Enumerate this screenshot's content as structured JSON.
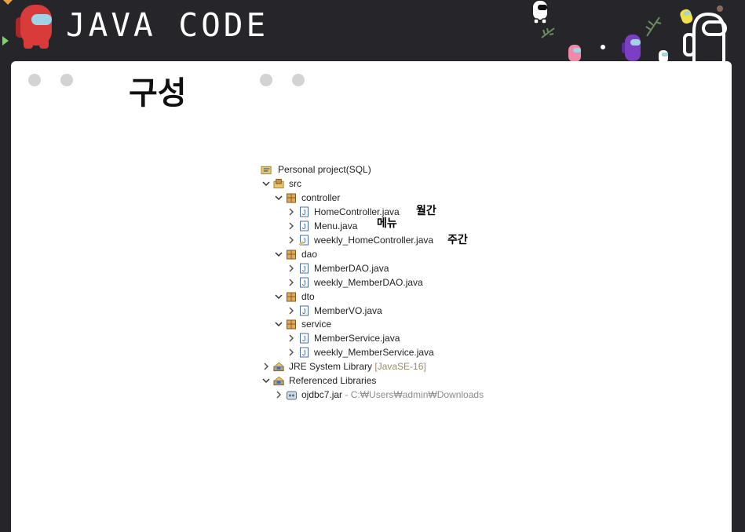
{
  "header": {
    "title": "JAVA CODE"
  },
  "card": {
    "heading": "구성"
  },
  "tree": {
    "project": "Personal project(SQL)",
    "src": "src",
    "pkg_controller": "controller",
    "file_home": "HomeController.java",
    "file_menu": "Menu.java",
    "file_weekly_home": "weekly_HomeController.java",
    "pkg_dao": "dao",
    "file_memberdao": "MemberDAO.java",
    "file_weekly_memberdao": "weekly_MemberDAO.java",
    "pkg_dto": "dto",
    "file_membervo": "MemberVO.java",
    "pkg_service": "service",
    "file_memberservice": "MemberService.java",
    "file_weekly_memberservice": "weekly_MemberService.java",
    "jre_label": "JRE System Library",
    "jre_version": "[JavaSE-16]",
    "ref_libs": "Referenced Libraries",
    "jar_name": "ojdbc7.jar",
    "jar_path": "- C:₩Users₩admin₩Downloads"
  },
  "annotations": {
    "monthly": "월간",
    "menu": "메뉴",
    "weekly": "주간"
  },
  "colors": {
    "header_bg": "#26262a",
    "card_bg": "#ffffff",
    "dot": "#d3d3d3",
    "crewmate_red": "#d93b3b",
    "crewmate_purple": "#7b3fc4",
    "crewmate_pink": "#f08aa8"
  },
  "icons": [
    "crewmate-red-icon",
    "crewmate-white-icon",
    "crewmate-purple-icon",
    "crewmate-pink-icon",
    "java-file-icon",
    "package-icon",
    "library-icon",
    "jar-icon",
    "project-icon",
    "chevron-down-icon",
    "chevron-right-icon"
  ]
}
